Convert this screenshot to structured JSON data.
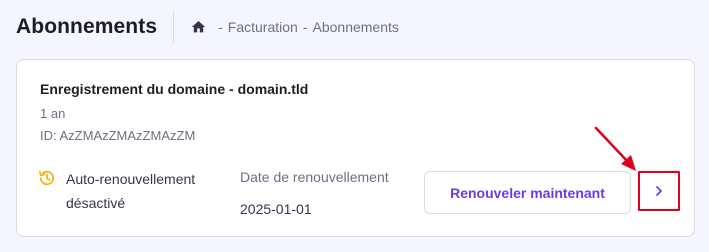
{
  "header": {
    "title": "Abonnements",
    "breadcrumb": {
      "home_icon": "home-icon",
      "separator": "-",
      "items": [
        "Facturation",
        "Abonnements"
      ]
    }
  },
  "subscription": {
    "title": "Enregistrement du domaine - domain.tld",
    "period": "1 an",
    "id": "ID: AzZMAzZMAzZMAzZM",
    "auto_renew": {
      "icon": "clock-history-icon",
      "label": "Auto-renouvellement désactivé"
    },
    "renewal_date": {
      "label": "Date de renouvellement",
      "value": "2025-01-01"
    },
    "renew_button_label": "Renouveler maintenant",
    "details_button_icon": "chevron-right-icon"
  },
  "colors": {
    "accent": "#673de6",
    "warning": "#ffab00",
    "annotation": "#e0001b"
  }
}
